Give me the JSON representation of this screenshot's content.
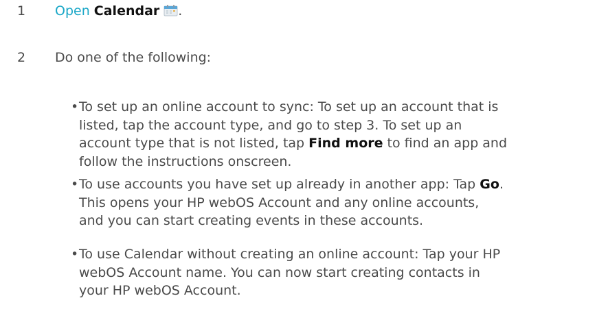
{
  "steps": [
    {
      "number": "1",
      "link_text": "Open",
      "app_name": "Calendar",
      "trailing": ".",
      "icon": "calendar-icon"
    },
    {
      "number": "2",
      "text": "Do one of the following:"
    }
  ],
  "bullets": [
    {
      "lines": [
        "To set up an online account to sync: To set up an account that is",
        "listed, tap the account type, and go to step 3. To set up an",
        {
          "before": "account type that is not listed, tap ",
          "bold": "Find more",
          "after": " to find an app and"
        },
        "follow the instructions onscreen."
      ]
    },
    {
      "lines": [
        {
          "before": "To use accounts you have set up already in another app: Tap ",
          "bold": "Go",
          "after": "."
        },
        "This opens your HP webOS Account and any online accounts,",
        "and you can start creating events in these accounts."
      ]
    },
    {
      "lines": [
        "To use Calendar without creating an online account: Tap your HP",
        "webOS Account name. You can now start creating contacts in",
        "your HP webOS Account."
      ]
    }
  ],
  "colors": {
    "link": "#1aa7c7",
    "body_text": "#4a4a4a",
    "bold_text": "#111111"
  }
}
